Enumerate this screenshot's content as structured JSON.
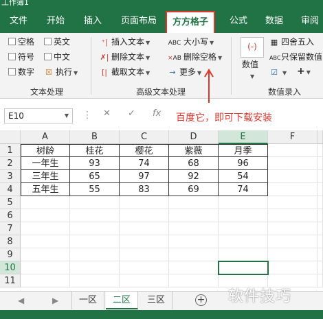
{
  "window": {
    "title": "工作簿1"
  },
  "tabs": [
    "文件",
    "开始",
    "插入",
    "页面布局",
    "方方格子",
    "公式",
    "数据",
    "审阅"
  ],
  "active_tab": "方方格子",
  "ribbon": {
    "text_group": {
      "label": "文本处理",
      "checks": [
        "空格",
        "英文",
        "符号",
        "中文",
        "数字"
      ],
      "execute": "执行"
    },
    "advanced_group": {
      "label": "高级文本处理",
      "items": [
        "插入文本",
        "删除文本",
        "截取文本",
        "大小写",
        "删除空格",
        "更多"
      ]
    },
    "number_group": {
      "label": "数值录入",
      "numeric": "数值",
      "round": "四舍五入",
      "keep_value": "只保留数值",
      "plus": "+",
      "abc": "ABC",
      "ab": "AB"
    }
  },
  "formula_bar": {
    "name_box": "E10",
    "cancel": "✕",
    "confirm": "✓",
    "fx": "fx",
    "annotation": "百度它，即可下载安装"
  },
  "sheet": {
    "columns": [
      "A",
      "B",
      "C",
      "D",
      "E",
      "F"
    ],
    "rows": [
      "1",
      "2",
      "3",
      "4",
      "5",
      "6",
      "7",
      "8",
      "9",
      "10",
      "11"
    ],
    "header_row": [
      "树龄",
      "桂花",
      "樱花",
      "紫薇",
      "月季"
    ],
    "data": [
      [
        "一年生",
        "93",
        "74",
        "68",
        "96"
      ],
      [
        "三年生",
        "65",
        "97",
        "92",
        "54"
      ],
      [
        "五年生",
        "55",
        "83",
        "69",
        "74"
      ]
    ],
    "active_cell": "E10"
  },
  "sheet_tabs": {
    "tabs": [
      "一区",
      "二区",
      "三区"
    ],
    "active": "二区",
    "add": "+"
  },
  "watermark": "软件技巧",
  "colors": {
    "brand": "#217346",
    "annotation": "#e0372d"
  }
}
